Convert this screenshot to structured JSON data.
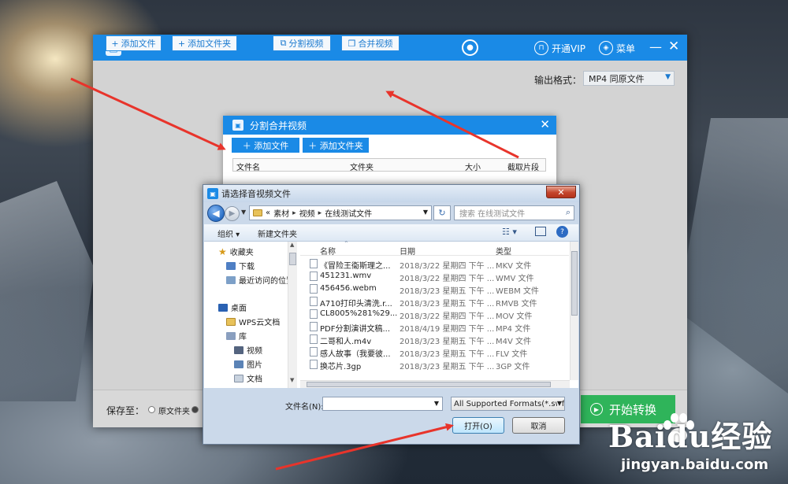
{
  "app": {
    "title": "",
    "vip_label": "开通VIP",
    "menu_label": "菜单",
    "toolbar": {
      "add_file": "添加文件",
      "add_folder": "添加文件夹",
      "split_video": "分割视频",
      "merge_video": "合并视频"
    },
    "output_format_label": "输出格式：",
    "output_format_value": "MP4  同原文件",
    "save_to_label": "保存至：",
    "save_option_original": "原文件夹",
    "start_button": "开始转换"
  },
  "merge_dialog": {
    "title": "分割合并视频",
    "add_file": "添加文件",
    "add_folder": "添加文件夹",
    "columns": [
      "文件名",
      "文件夹",
      "大小",
      "截取片段"
    ]
  },
  "picker": {
    "title": "请选择音视频文件",
    "breadcrumb": [
      "素材",
      "视频",
      "在线测试文件"
    ],
    "breadcrumb_prefix": "«",
    "search_placeholder": "搜索 在线测试文件",
    "organize": "组织 ▾",
    "new_folder": "新建文件夹",
    "nav": [
      {
        "label": "收藏夹",
        "icon": "star-icon"
      },
      {
        "label": "下载",
        "icon": "download-folder-icon"
      },
      {
        "label": "最近访问的位置",
        "icon": "recent-places-icon"
      },
      {
        "label": "桌面",
        "icon": "desktop-icon"
      },
      {
        "label": "WPS云文档",
        "icon": "folder-icon"
      },
      {
        "label": "库",
        "icon": "library-icon"
      },
      {
        "label": "视频",
        "icon": "video-library-icon"
      },
      {
        "label": "图片",
        "icon": "picture-library-icon"
      },
      {
        "label": "文档",
        "icon": "document-library-icon"
      }
    ],
    "columns": [
      "名称",
      "日期",
      "类型"
    ],
    "files": [
      {
        "name": "《冒险王衞斯理之...",
        "date": "2018/3/22 星期四 下午 ...",
        "type": "MKV 文件"
      },
      {
        "name": "451231.wmv",
        "date": "2018/3/22 星期四 下午 ...",
        "type": "WMV 文件"
      },
      {
        "name": "456456.webm",
        "date": "2018/3/23 星期五 下午 ...",
        "type": "WEBM 文件"
      },
      {
        "name": "A710打印头清洗.r...",
        "date": "2018/3/23 星期五 下午 ...",
        "type": "RMVB 文件"
      },
      {
        "name": "CL8005%281%29....",
        "date": "2018/3/22 星期四 下午 ...",
        "type": "MOV 文件"
      },
      {
        "name": "PDF分割演讲文稿...",
        "date": "2018/4/19 星期四 下午 ...",
        "type": "MP4 文件"
      },
      {
        "name": "二哥和人.m4v",
        "date": "2018/3/23 星期五 下午 ...",
        "type": "M4V 文件"
      },
      {
        "name": "感人故事（我要彼...",
        "date": "2018/3/23 星期五 下午 ...",
        "type": "FLV 文件"
      },
      {
        "name": "换芯片.3gp",
        "date": "2018/3/23 星期五 下午 ...",
        "type": "3GP 文件"
      }
    ],
    "filename_label": "文件名(N):",
    "filename_value": "",
    "format_filter": "All Supported Formats(*.swf;",
    "open_button": "打开(O)",
    "cancel_button": "取消"
  },
  "watermark": {
    "logo": "Baidu经验",
    "url": "jingyan.baidu.com"
  },
  "colors": {
    "accent": "#1a8ae6",
    "start": "#2fb45a",
    "annotation": "#e8342b"
  }
}
